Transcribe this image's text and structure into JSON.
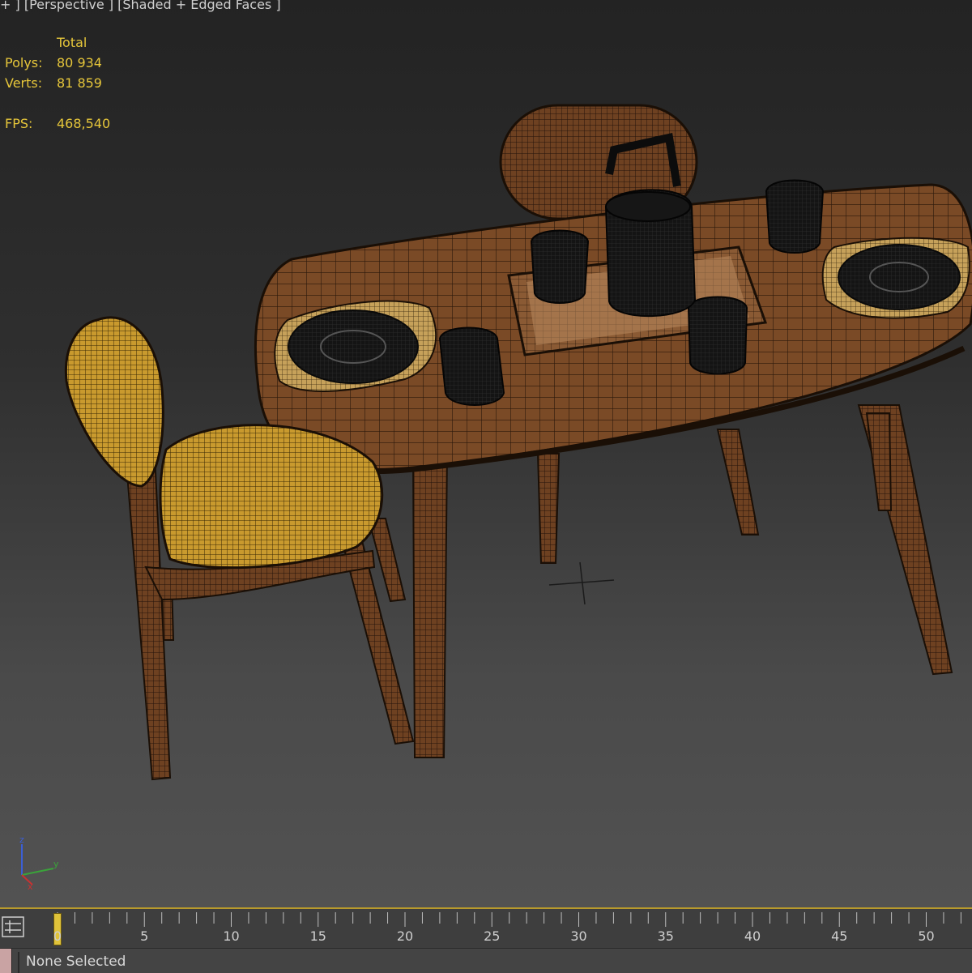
{
  "viewport": {
    "label": "+ ] [Perspective ] [Shaded + Edged Faces ]"
  },
  "stats": {
    "header": "Total",
    "polys_label": "Polys:",
    "polys_value": "80 934",
    "verts_label": "Verts:",
    "verts_value": "81 859",
    "fps_label": "FPS:",
    "fps_value": "468,540"
  },
  "gizmo": {
    "z_label": "z",
    "y_label": "y",
    "x_label": "x"
  },
  "timeline": {
    "current_frame": "0",
    "tick_labels": [
      "5",
      "10",
      "15",
      "20",
      "25",
      "30",
      "35",
      "40",
      "45",
      "50"
    ]
  },
  "status_bar": {
    "selection_text": "None Selected"
  },
  "colors": {
    "stats_text": "#e6c63a",
    "wood": "#7a4a26",
    "cushion": "#c99a2e",
    "timeline_accent": "#b89a2c"
  }
}
